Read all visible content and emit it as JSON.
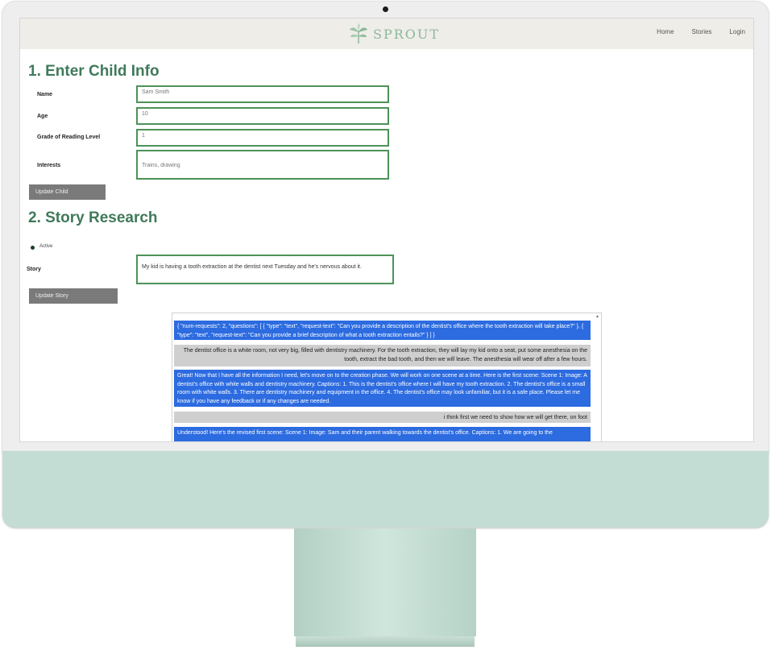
{
  "nav": {
    "logo": "SPROUT",
    "links": [
      "Home",
      "Stories",
      "Login"
    ]
  },
  "child_info": {
    "title": "1. Enter Child Info",
    "fields": [
      {
        "label": "Name",
        "value": "Sam Smith"
      },
      {
        "label": "Age",
        "value": "10"
      },
      {
        "label": "Grade of Reading Level",
        "value": "1"
      },
      {
        "label": "Interests",
        "value": "Trains, drawing"
      }
    ],
    "button": "Update Child"
  },
  "story_research": {
    "title": "2. Story Research",
    "status": "Active",
    "story_label": "Story",
    "story_value": "My kid is having a tooth extraction at the dentist next Tuesday and he's nervous about it.",
    "button": "Update Story"
  },
  "chat": {
    "messages": [
      {
        "role": "bot",
        "text": "{ \"num-requests\": 2, \"questions\": [ { \"type\": \"text\", \"request-text\": \"Can you provide a description of the dentist's office where the tooth extraction will take place?\" }, { \"type\": \"text\", \"request-text\": \"Can you provide a brief description of what a tooth extraction entails?\" } ] }"
      },
      {
        "role": "user",
        "text": "The dentist office is a white room, not very big, filled with dentistry machinery. For the tooth extraction, they will lay my kid onto a seat, put some anesthesia on the tooth, extract the bad tooth, and then we will leave. The anesthesia will wear off after a few hours."
      },
      {
        "role": "bot",
        "text": "Great! Now that I have all the information I need, let's move on to the creation phase. We will work on one scene at a time. Here is the first scene: Scene 1: Image: A dentist's office with white walls and dentistry machinery. Captions: 1. This is the dentist's office where I will have my tooth extraction. 2. The dentist's office is a small room with white walls. 3. There are dentistry machinery and equipment in the office. 4. The dentist's office may look unfamiliar, but it is a safe place. Please let me know if you have any feedback or if any changes are needed."
      },
      {
        "role": "user",
        "text": "i think first we need to show how we will get there, on foot"
      },
      {
        "role": "bot",
        "text": "Understood! Here's the revised first scene: Scene 1: Image: Sam and their parent walking towards the dentist's office. Captions: 1. We are going to the"
      }
    ]
  },
  "colors": {
    "accent_green": "#4d9258",
    "title_green": "#3f7a5a",
    "bot_bubble": "#2c6be0",
    "user_bubble": "#cfcfcf",
    "monitor_chin": "#c3ddd4"
  }
}
